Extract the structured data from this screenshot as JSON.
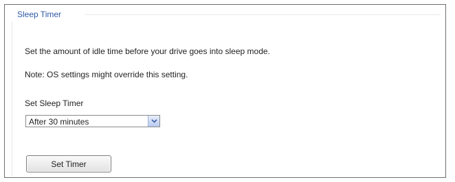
{
  "panel": {
    "title": "Sleep Timer",
    "description": "Set the amount of idle time before your drive goes into sleep mode.",
    "note": "Note: OS settings might override this setting.",
    "timer_label": "Set Sleep Timer"
  },
  "timer_select": {
    "selected": "After 30 minutes",
    "icon": "chevron-down-icon"
  },
  "set_button": {
    "label": "Set Timer"
  },
  "colors": {
    "title": "#2f59a8",
    "text": "#222222",
    "border": "#6d6d6d"
  }
}
